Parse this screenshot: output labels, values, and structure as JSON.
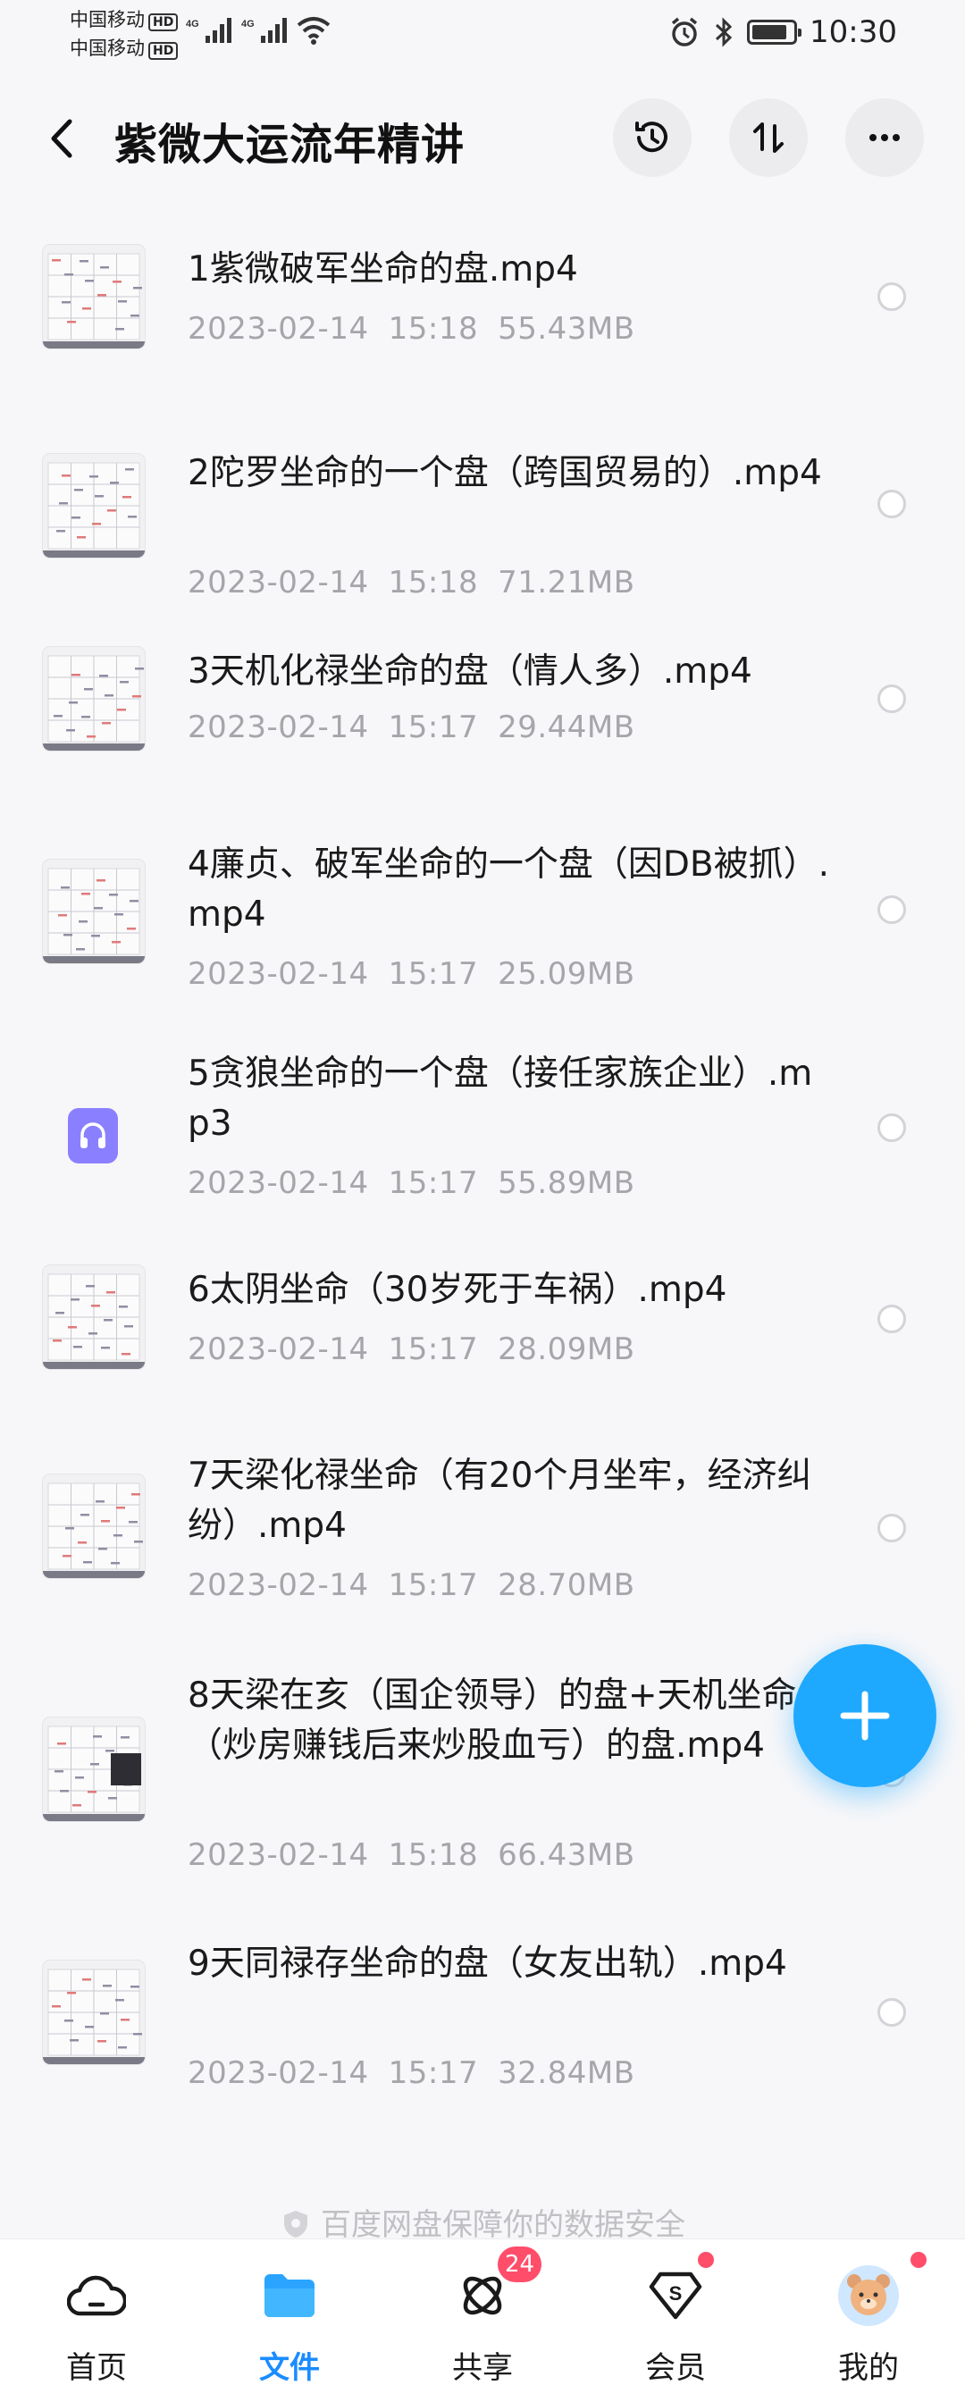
{
  "status_bar": {
    "carrier1": "中国移动",
    "carrier2": "中国移动",
    "hd_badge": "HD",
    "network1": "4G",
    "network2": "4G",
    "time": "10:30",
    "icons": [
      "alarm-icon",
      "bluetooth-icon",
      "battery-icon",
      "wifi-icon",
      "signal-icon"
    ]
  },
  "header": {
    "title": "紫微大运流年精讲",
    "buttons": [
      "back-icon",
      "history-icon",
      "sort-icon",
      "more-icon"
    ]
  },
  "files": [
    {
      "name": "1紫微破军坐命的盘.mp4",
      "date": "2023-02-14",
      "time": "15:18",
      "size": "55.43MB",
      "type": "video"
    },
    {
      "name": "2陀罗坐命的一个盘（跨国贸易的）.mp4",
      "date": "2023-02-14",
      "time": "15:18",
      "size": "71.21MB",
      "type": "video"
    },
    {
      "name": "3天机化禄坐命的盘（情人多）.mp4",
      "date": "2023-02-14",
      "time": "15:17",
      "size": "29.44MB",
      "type": "video"
    },
    {
      "name": "4廉贞、破军坐命的一个盘（因DB被抓）.mp4",
      "date": "2023-02-14",
      "time": "15:17",
      "size": "25.09MB",
      "type": "video"
    },
    {
      "name": "5贪狼坐命的一个盘（接任家族企业）.mp3",
      "date": "2023-02-14",
      "time": "15:17",
      "size": "55.89MB",
      "type": "audio"
    },
    {
      "name": "6太阴坐命（30岁死于车祸）.mp4",
      "date": "2023-02-14",
      "time": "15:17",
      "size": "28.09MB",
      "type": "video"
    },
    {
      "name": "7天梁化禄坐命（有20个月坐牢，经济纠纷）.mp4",
      "date": "2023-02-14",
      "time": "15:17",
      "size": "28.70MB",
      "type": "video"
    },
    {
      "name": "8天梁在亥（国企领导）的盘+天机坐命（炒房赚钱后来炒股血亏）的盘.mp4",
      "date": "2023-02-14",
      "time": "15:18",
      "size": "66.43MB",
      "type": "video"
    },
    {
      "name": "9天同禄存坐命的盘（女友出轨）.mp4",
      "date": "2023-02-14",
      "time": "15:17",
      "size": "32.84MB",
      "type": "video"
    }
  ],
  "safety_note": "百度网盘保障你的数据安全",
  "tabs": [
    {
      "label": "首页",
      "icon": "cloud-icon"
    },
    {
      "label": "文件",
      "icon": "folder-icon",
      "active": true
    },
    {
      "label": "共享",
      "icon": "share-icon",
      "badge": "24"
    },
    {
      "label": "会员",
      "icon": "vip-icon",
      "dot": true
    },
    {
      "label": "我的",
      "icon": "avatar",
      "dot": true
    }
  ],
  "colors": {
    "accent": "#1a8cff",
    "fab": "#1ea9ff",
    "badge": "#ff4d6a",
    "audio_icon": "#8a80ff",
    "meta_text": "#a5a5ab"
  }
}
